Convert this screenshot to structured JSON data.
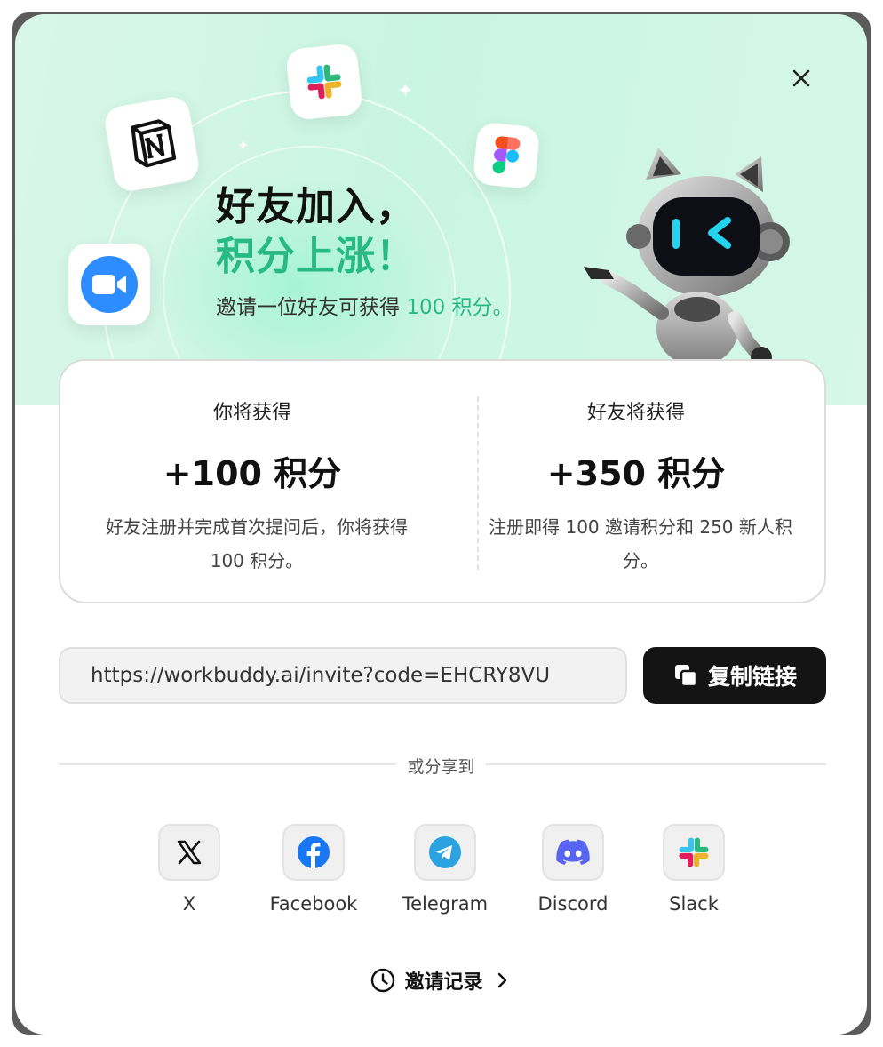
{
  "hero": {
    "title_line1": "好友加入，",
    "title_line2": "积分上涨！",
    "subtitle_prefix": "邀请一位好友可获得 ",
    "subtitle_highlight": "100 积分。",
    "accent_color": "#27b986",
    "app_icons": [
      "notion-icon",
      "slack-icon",
      "figma-icon",
      "zoom-icon"
    ]
  },
  "close": {
    "icon": "close-icon"
  },
  "rewards": {
    "you": {
      "label": "你将获得",
      "value": "+100 积分",
      "description": "好友注册并完成首次提问后，你将获得 100 积分。"
    },
    "friend": {
      "label": "好友将获得",
      "value": "+350 积分",
      "description": "注册即得 100 邀请积分和 250 新人积分。"
    }
  },
  "invite": {
    "link": "https://workbuddy.ai/invite?code=EHCRY8VU",
    "copy_label": "复制链接"
  },
  "share": {
    "divider_text": "或分享到",
    "items": [
      {
        "label": "X",
        "icon": "x-icon"
      },
      {
        "label": "Facebook",
        "icon": "facebook-icon",
        "color": "#1877f2"
      },
      {
        "label": "Telegram",
        "icon": "telegram-icon",
        "color": "#2aa3e0"
      },
      {
        "label": "Discord",
        "icon": "discord-icon",
        "color": "#5865f2"
      },
      {
        "label": "Slack",
        "icon": "slack-icon"
      }
    ]
  },
  "history": {
    "label": "邀请记录",
    "icon": "clock-icon"
  }
}
